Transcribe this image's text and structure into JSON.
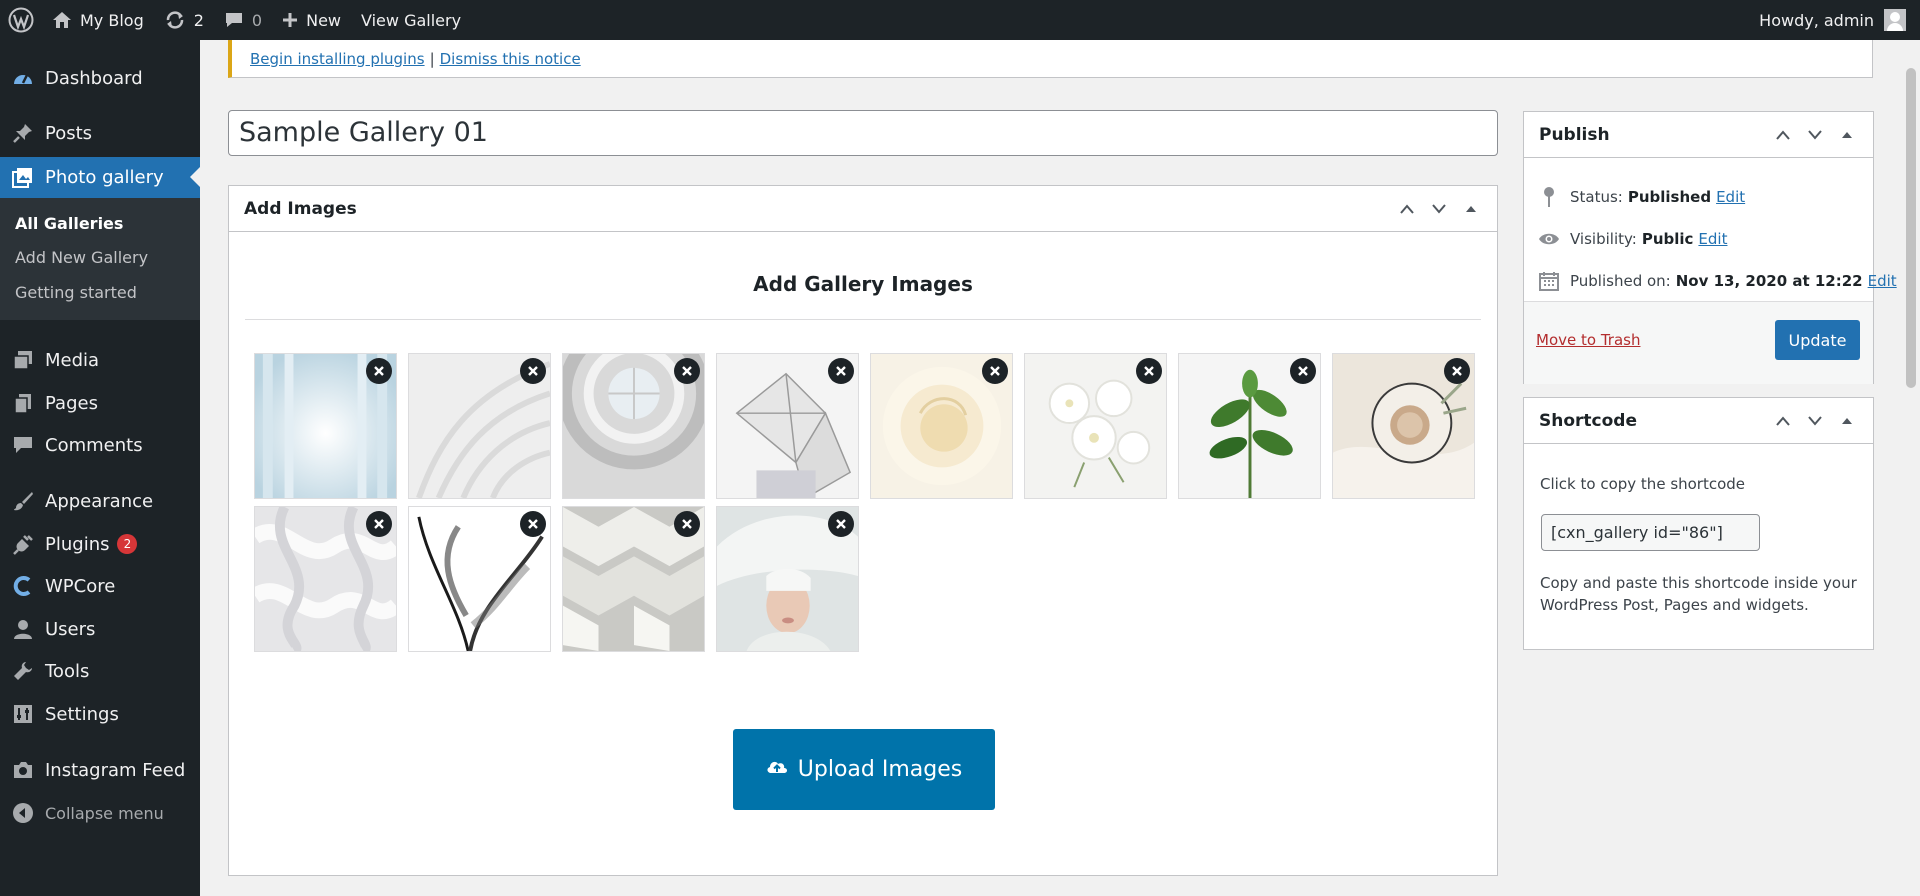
{
  "adminbar": {
    "site_name": "My Blog",
    "updates_count": "2",
    "comments_count": "0",
    "new_label": "New",
    "view_gallery_label": "View Gallery",
    "greeting": "Howdy, admin"
  },
  "sidebar": {
    "dashboard": "Dashboard",
    "posts": "Posts",
    "photo_gallery": "Photo gallery",
    "sub": [
      "All Galleries",
      "Add New Gallery",
      "Getting started"
    ],
    "media": "Media",
    "pages": "Pages",
    "comments": "Comments",
    "appearance": "Appearance",
    "plugins": "Plugins",
    "plugins_badge": "2",
    "wpcore": "WPCore",
    "users": "Users",
    "tools": "Tools",
    "settings": "Settings",
    "instagram_feed": "Instagram Feed",
    "collapse": "Collapse menu"
  },
  "notice": {
    "begin_link": "Begin installing plugins",
    "separator": "|",
    "dismiss_link": "Dismiss this notice"
  },
  "post": {
    "title": "Sample Gallery 01"
  },
  "add_images": {
    "box_title": "Add Images",
    "heading": "Add Gallery Images",
    "upload_label": "Upload Images"
  },
  "publish": {
    "box_title": "Publish",
    "status_label": "Status:",
    "status_value": "Published",
    "visibility_label": "Visibility:",
    "visibility_value": "Public",
    "published_label": "Published on:",
    "published_value": "Nov 13, 2020 at 12:22",
    "edit_label": "Edit",
    "trash_label": "Move to Trash",
    "update_label": "Update"
  },
  "shortcode": {
    "box_title": "Shortcode",
    "copy_text": "Click to copy the shortcode",
    "value": "[cxn_gallery id=\"86\"]",
    "help_text": "Copy and paste this shortcode inside your WordPress Post, Pages and widgets."
  },
  "colors": {
    "admin_dark": "#1d2327",
    "accent_blue": "#2271b1",
    "upload_blue": "#0073aa",
    "notice_yellow": "#dba617",
    "badge_red": "#d63638",
    "trash_red": "#b32d2e"
  }
}
